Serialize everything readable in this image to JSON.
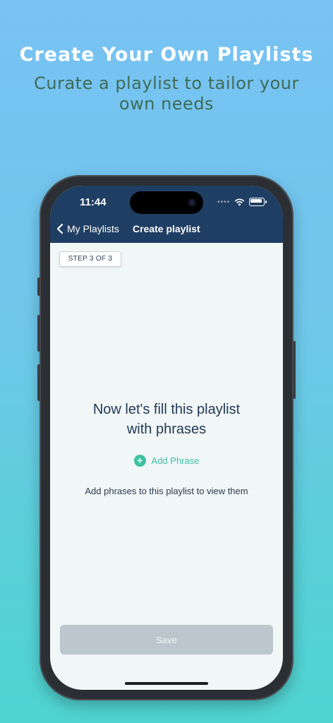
{
  "marketing": {
    "headline": "Create Your Own Playlists",
    "subhead": "Curate a playlist to tailor your own needs"
  },
  "status_bar": {
    "time": "11:44",
    "icons": [
      "cellular-dots-icon",
      "wifi-icon",
      "battery-icon"
    ]
  },
  "nav": {
    "back_label": "My Playlists",
    "title": "Create playlist"
  },
  "step": {
    "label": "STEP 3 OF 3"
  },
  "empty_state": {
    "title_line1": "Now let's fill this playlist",
    "title_line2": "with phrases",
    "add_label": "Add Phrase",
    "hint": "Add phrases to this playlist to view them"
  },
  "footer": {
    "save_label": "Save"
  },
  "colors": {
    "nav_bg": "#1f3e63",
    "accent": "#3fc0a2",
    "disabled_button": "#bcc6cd"
  }
}
